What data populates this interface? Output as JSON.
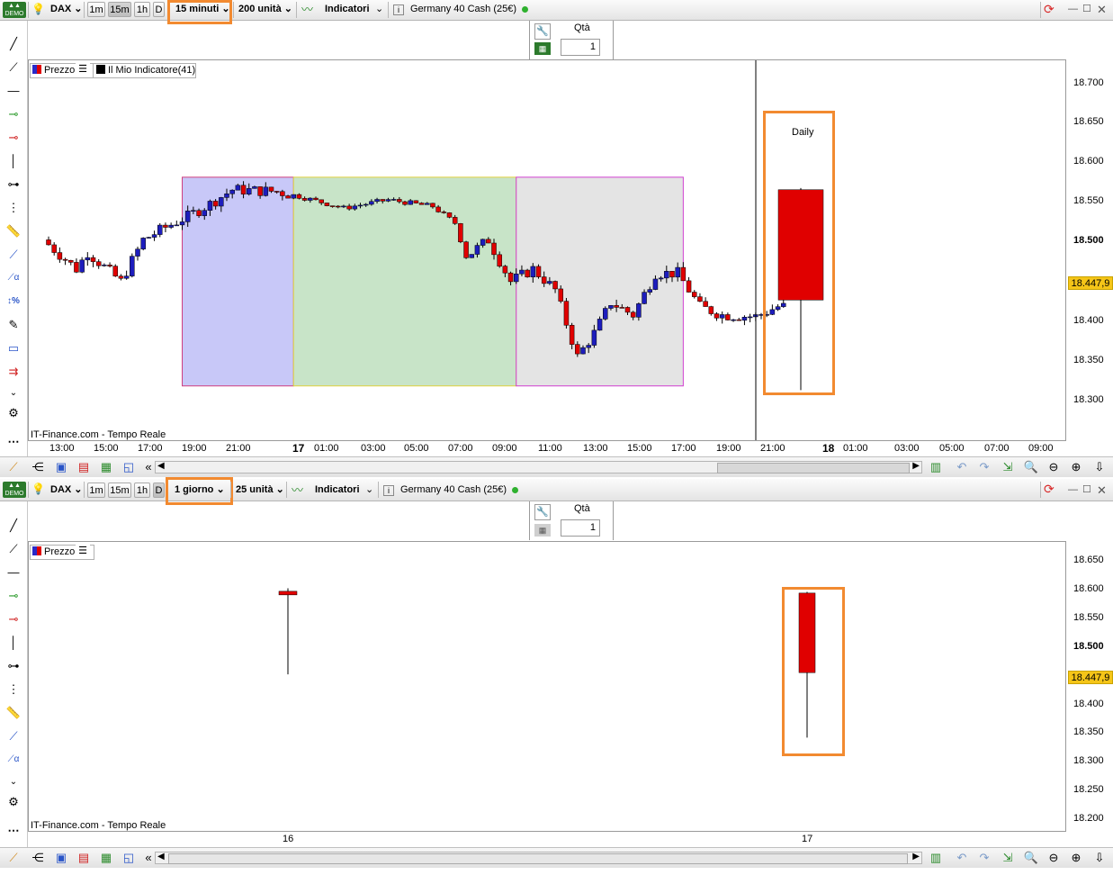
{
  "top": {
    "toolbar": {
      "instrument": "DAX",
      "tf_buttons": [
        "1m",
        "15m",
        "1h",
        "D"
      ],
      "timeframe": "15 minuti",
      "units": "200 unità",
      "indicators": "Indicatori",
      "info_icon": "i",
      "market": "Germany 40 Cash (25€)"
    },
    "qta_label": "Qtà",
    "qta_value": "1",
    "legend_price": "Prezzo",
    "legend_indicator": "Il Mio Indicatore(41)",
    "watermark": "IT-Finance.com - Tempo Reale",
    "daily_label": "Daily",
    "current_price": "18.447,9",
    "y_labels": [
      "18.700",
      "18.650",
      "18.600",
      "18.550",
      "18.500",
      "18.400",
      "18.350",
      "18.300"
    ],
    "x_labels": [
      "13:00",
      "15:00",
      "17:00",
      "19:00",
      "21:00",
      "17",
      "01:00",
      "03:00",
      "05:00",
      "07:00",
      "09:00",
      "11:00",
      "13:00",
      "15:00",
      "17:00",
      "19:00",
      "21:00",
      "18",
      "01:00",
      "03:00",
      "05:00",
      "07:00",
      "09:00"
    ]
  },
  "bottom": {
    "toolbar": {
      "instrument": "DAX",
      "tf_buttons": [
        "1m",
        "15m",
        "1h",
        "D"
      ],
      "timeframe": "1 giorno",
      "units": "25 unità",
      "indicators": "Indicatori",
      "info_icon": "i",
      "market": "Germany 40 Cash (25€)"
    },
    "qta_label": "Qtà",
    "qta_value": "1",
    "legend_price": "Prezzo",
    "watermark": "IT-Finance.com - Tempo Reale",
    "current_price": "18.447,9",
    "y_labels": [
      "18.650",
      "18.600",
      "18.550",
      "18.500",
      "18.400",
      "18.350",
      "18.300",
      "18.250",
      "18.200"
    ],
    "x_labels": [
      "16",
      "17"
    ]
  },
  "colors": {
    "bull": "#1d1dbd",
    "bear": "#e00000",
    "highlight": "#f28a30",
    "zone_asia": "#c8c8f8",
    "zone_europe": "#c8e4c8",
    "zone_us": "#e4e4e4"
  },
  "icons": {
    "left_tools": [
      "line-icon",
      "segment-icon",
      "horizontal-line-icon",
      "buy-level-icon",
      "sell-level-icon",
      "vertical-line-icon",
      "ray-icon",
      "point-icon",
      "ruler-icon",
      "fibonacci-icon",
      "percent-icon",
      "pen-icon",
      "rectangle-icon",
      "channel-icon",
      "expand-icon",
      "demo-icon",
      "more-icon"
    ]
  },
  "chart_data": [
    {
      "type": "candlestick",
      "title": "",
      "timeframe": "15 minuti",
      "ylim": [
        18280,
        18735
      ],
      "zones": [
        {
          "from": "19:00",
          "to": "00:00",
          "color": "blue"
        },
        {
          "from": "00:00",
          "to": "10:00",
          "color": "green"
        },
        {
          "from": "10:00",
          "to": "17:30",
          "color": "grey"
        }
      ],
      "projected_daily_candle": {
        "label": "Daily",
        "open": 18580,
        "close": 18447.9,
        "high": 18582,
        "low": 18340
      },
      "current_price": 18447.9
    },
    {
      "type": "candlestick",
      "title": "",
      "timeframe": "1 giorno",
      "ylim": [
        18185,
        18665
      ],
      "categories": [
        "16",
        "17"
      ],
      "candles": [
        {
          "date": "16",
          "open": 18577,
          "close": 18583,
          "high": 18588,
          "low": 18445
        },
        {
          "date": "17",
          "open": 18580,
          "close": 18447.9,
          "high": 18582,
          "low": 18340
        }
      ],
      "current_price": 18447.9
    }
  ]
}
